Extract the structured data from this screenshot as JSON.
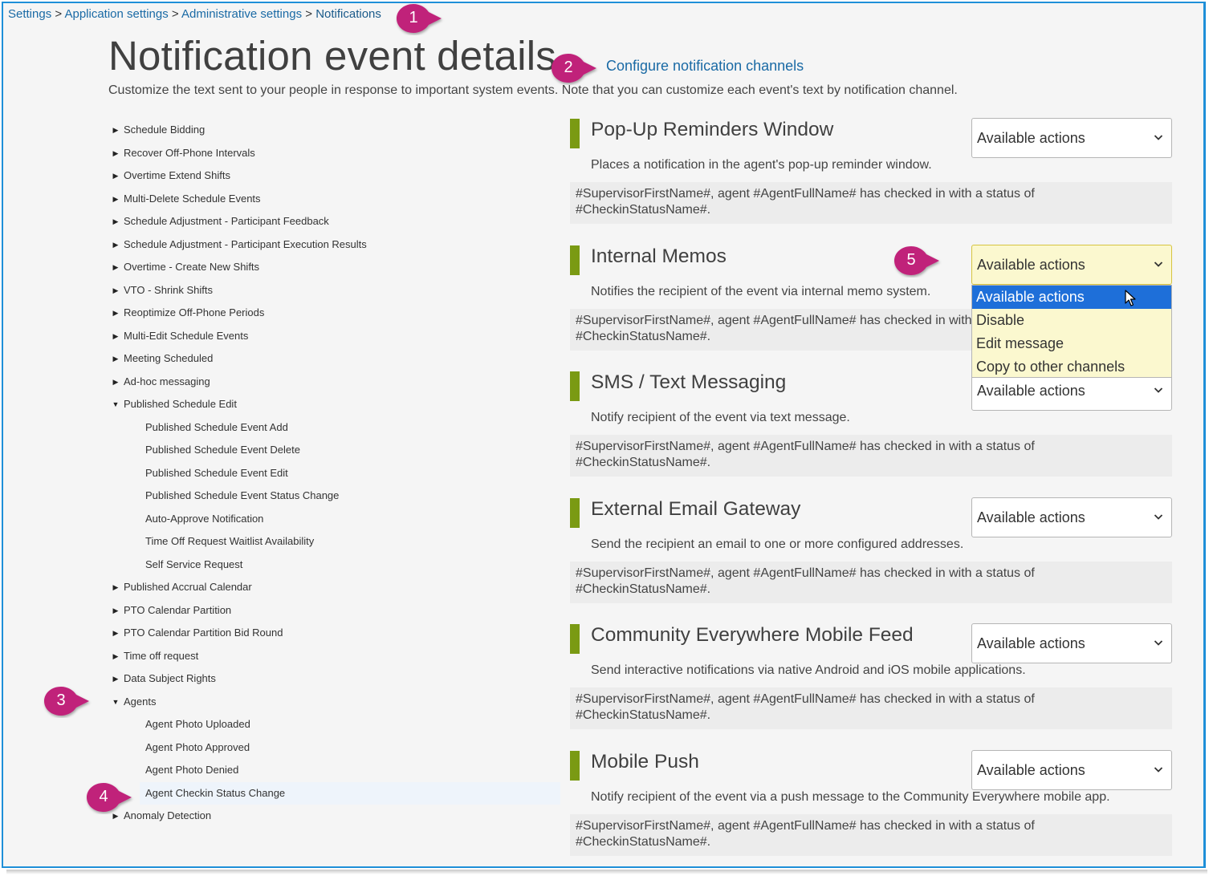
{
  "breadcrumb": {
    "items": [
      "Settings",
      "Application settings",
      "Administrative settings",
      "Notifications"
    ],
    "separator": ">"
  },
  "page": {
    "title": "Notification event details",
    "config_link": "Configure notification channels",
    "description": "Customize the text sent to your people in response to important system events. Note that you can customize each event's text by notification channel."
  },
  "tree": {
    "items": [
      {
        "label": "Schedule Bidding",
        "state": "collapsed"
      },
      {
        "label": "Recover Off-Phone Intervals",
        "state": "collapsed"
      },
      {
        "label": "Overtime Extend Shifts",
        "state": "collapsed"
      },
      {
        "label": "Multi-Delete Schedule Events",
        "state": "collapsed"
      },
      {
        "label": "Schedule Adjustment - Participant Feedback",
        "state": "collapsed"
      },
      {
        "label": "Schedule Adjustment - Participant Execution Results",
        "state": "collapsed"
      },
      {
        "label": "Overtime - Create New Shifts",
        "state": "collapsed"
      },
      {
        "label": "VTO - Shrink Shifts",
        "state": "collapsed"
      },
      {
        "label": "Reoptimize Off-Phone Periods",
        "state": "collapsed"
      },
      {
        "label": "Multi-Edit Schedule Events",
        "state": "collapsed"
      },
      {
        "label": "Meeting Scheduled",
        "state": "collapsed"
      },
      {
        "label": "Ad-hoc messaging",
        "state": "collapsed"
      },
      {
        "label": "Published Schedule Edit",
        "state": "expanded"
      },
      {
        "label": "Published Schedule Event Add",
        "state": "child"
      },
      {
        "label": "Published Schedule Event Delete",
        "state": "child"
      },
      {
        "label": "Published Schedule Event Edit",
        "state": "child"
      },
      {
        "label": "Published Schedule Event Status Change",
        "state": "child"
      },
      {
        "label": "Auto-Approve Notification",
        "state": "child"
      },
      {
        "label": "Time Off Request Waitlist Availability",
        "state": "child"
      },
      {
        "label": "Self Service Request",
        "state": "child"
      },
      {
        "label": "Published Accrual Calendar",
        "state": "collapsed"
      },
      {
        "label": "PTO Calendar Partition",
        "state": "collapsed"
      },
      {
        "label": "PTO Calendar Partition Bid Round",
        "state": "collapsed"
      },
      {
        "label": "Time off request",
        "state": "collapsed"
      },
      {
        "label": "Data Subject Rights",
        "state": "collapsed"
      },
      {
        "label": "Agents",
        "state": "expanded"
      },
      {
        "label": "Agent Photo Uploaded",
        "state": "child"
      },
      {
        "label": "Agent Photo Approved",
        "state": "child"
      },
      {
        "label": "Agent Photo Denied",
        "state": "child"
      },
      {
        "label": "Agent Checkin Status Change",
        "state": "selected"
      },
      {
        "label": "Anomaly Detection",
        "state": "collapsed"
      }
    ]
  },
  "channels": [
    {
      "title": "Pop-Up Reminders Window",
      "description": "Places a notification in the agent's pop-up reminder window.",
      "message": "#SupervisorFirstName#, agent #AgentFullName# has checked in with a status of #CheckinStatusName#.",
      "action": "Available actions"
    },
    {
      "title": "Internal Memos",
      "description": "Notifies the recipient of the event via internal memo system.",
      "message": "#SupervisorFirstName#, agent #AgentFullName# has checked in with a status of #CheckinStatusName#.",
      "action": "Available actions"
    },
    {
      "title": "SMS / Text Messaging",
      "description": "Notify recipient of the event via text message.",
      "message": "#SupervisorFirstName#, agent #AgentFullName# has checked in with a status of #CheckinStatusName#.",
      "action": "Available actions"
    },
    {
      "title": "External Email Gateway",
      "description": "Send the recipient an email to one or more configured addresses.",
      "message": "#SupervisorFirstName#, agent #AgentFullName# has checked in with a status of #CheckinStatusName#.",
      "action": "Available actions"
    },
    {
      "title": "Community Everywhere Mobile Feed",
      "description": "Send interactive notifications via native Android and iOS mobile applications.",
      "message": "#SupervisorFirstName#, agent #AgentFullName# has checked in with a status of #CheckinStatusName#.",
      "action": "Available actions"
    },
    {
      "title": "Mobile Push",
      "description": "Notify recipient of the event via a push message to the Community Everywhere mobile app.",
      "message": "#SupervisorFirstName#, agent #AgentFullName# has checked in with a status of #CheckinStatusName#.",
      "action": "Available actions"
    }
  ],
  "dropdown": {
    "options": [
      "Available actions",
      "Disable",
      "Edit message",
      "Copy to other channels"
    ],
    "highlighted": "Available actions"
  },
  "callouts": [
    "1",
    "2",
    "3",
    "4",
    "5"
  ],
  "icons": {
    "collapsed": "caret-right-icon",
    "expanded": "caret-down-icon",
    "select": "chevron-down-icon",
    "pointer": "mouse-pointer-icon"
  },
  "colors": {
    "link": "#1a6aa5",
    "accent_bar": "#7a9a13",
    "callout": "#c0237a",
    "dropdown_bg": "#fbf8cf",
    "highlight": "#1e6fd9",
    "frame_border": "#1e8fd8"
  }
}
